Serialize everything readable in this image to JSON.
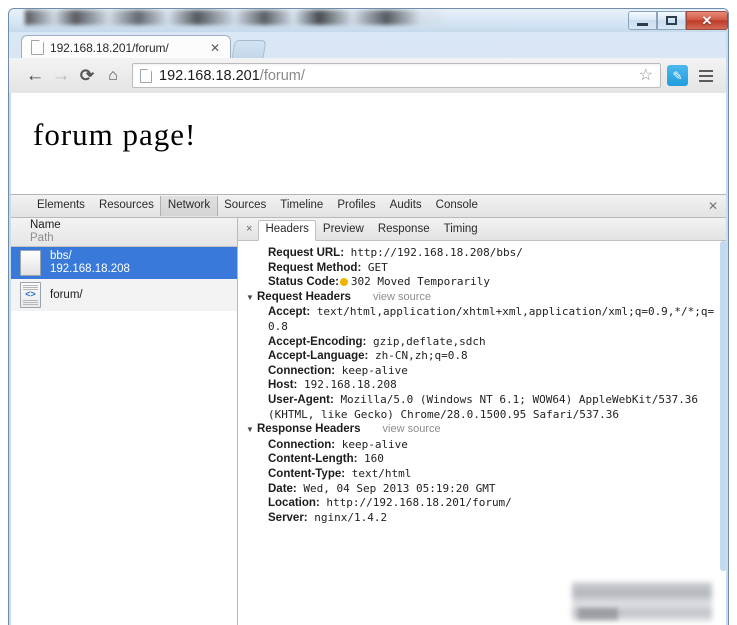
{
  "window": {
    "controls": {
      "minimize": "minimize-button",
      "maximize": "maximize-button",
      "close_label": "✕"
    }
  },
  "browser": {
    "tab": {
      "title": "192.168.18.201/forum/",
      "close_label": "✕"
    },
    "toolbar": {
      "back_label": "←",
      "forward_label": "→",
      "reload_label": "⟳",
      "home_label": "⌂",
      "url_scheme": "",
      "url_host": "192.168.18.201",
      "url_path": "/forum/",
      "star_label": "☆",
      "extension_label": "✎",
      "menu_label": "menu"
    }
  },
  "page": {
    "heading": "forum page!"
  },
  "devtools": {
    "tabs": [
      {
        "label": "Elements",
        "selected": false
      },
      {
        "label": "Resources",
        "selected": false
      },
      {
        "label": "Network",
        "selected": true
      },
      {
        "label": "Sources",
        "selected": false
      },
      {
        "label": "Timeline",
        "selected": false
      },
      {
        "label": "Profiles",
        "selected": false
      },
      {
        "label": "Audits",
        "selected": false
      },
      {
        "label": "Console",
        "selected": false
      }
    ],
    "close_label": "✕",
    "requests_panel": {
      "column_name": "Name",
      "column_path": "Path",
      "rows": [
        {
          "name": "bbs/",
          "path": "192.168.18.208",
          "selected": true,
          "icon": "document-icon"
        },
        {
          "name": "forum/",
          "path": "",
          "selected": false,
          "icon": "code-document-icon"
        }
      ]
    },
    "detail_panel": {
      "close_label": "×",
      "sub_tabs": [
        {
          "label": "Headers",
          "selected": true
        },
        {
          "label": "Preview",
          "selected": false
        },
        {
          "label": "Response",
          "selected": false
        },
        {
          "label": "Timing",
          "selected": false
        }
      ],
      "general": [
        {
          "key": "Request URL:",
          "value": "http://192.168.18.208/bbs/"
        },
        {
          "key": "Request Method:",
          "value": "GET"
        }
      ],
      "status": {
        "key": "Status Code:",
        "dot_color": "#f0b400",
        "value": "302 Moved Temporarily"
      },
      "request_headers": {
        "title": "Request Headers",
        "view_source": "view source",
        "disclosure": "▼",
        "items": [
          {
            "key": "Accept:",
            "value": "text/html,application/xhtml+xml,application/xml;q=0.9,*/*;q=0.8"
          },
          {
            "key": "Accept-Encoding:",
            "value": "gzip,deflate,sdch"
          },
          {
            "key": "Accept-Language:",
            "value": "zh-CN,zh;q=0.8"
          },
          {
            "key": "Connection:",
            "value": "keep-alive"
          },
          {
            "key": "Host:",
            "value": "192.168.18.208"
          },
          {
            "key": "User-Agent:",
            "value": "Mozilla/5.0 (Windows NT 6.1; WOW64) AppleWebKit/537.36 (KHTML, like Gecko) Chrome/28.0.1500.95 Safari/537.36"
          }
        ]
      },
      "response_headers": {
        "title": "Response Headers",
        "view_source": "view source",
        "disclosure": "▼",
        "items": [
          {
            "key": "Connection:",
            "value": "keep-alive"
          },
          {
            "key": "Content-Length:",
            "value": "160"
          },
          {
            "key": "Content-Type:",
            "value": "text/html"
          },
          {
            "key": "Date:",
            "value": "Wed, 04 Sep 2013 05:19:20 GMT"
          },
          {
            "key": "Location:",
            "value": "http://192.168.18.201/forum/"
          },
          {
            "key": "Server:",
            "value": "nginx/1.4.2"
          }
        ]
      }
    }
  },
  "colors": {
    "selection_blue": "#3879d9",
    "close_red": "#bd3c29",
    "status_orange": "#f0b400",
    "extension_blue": "#1e9ede"
  }
}
